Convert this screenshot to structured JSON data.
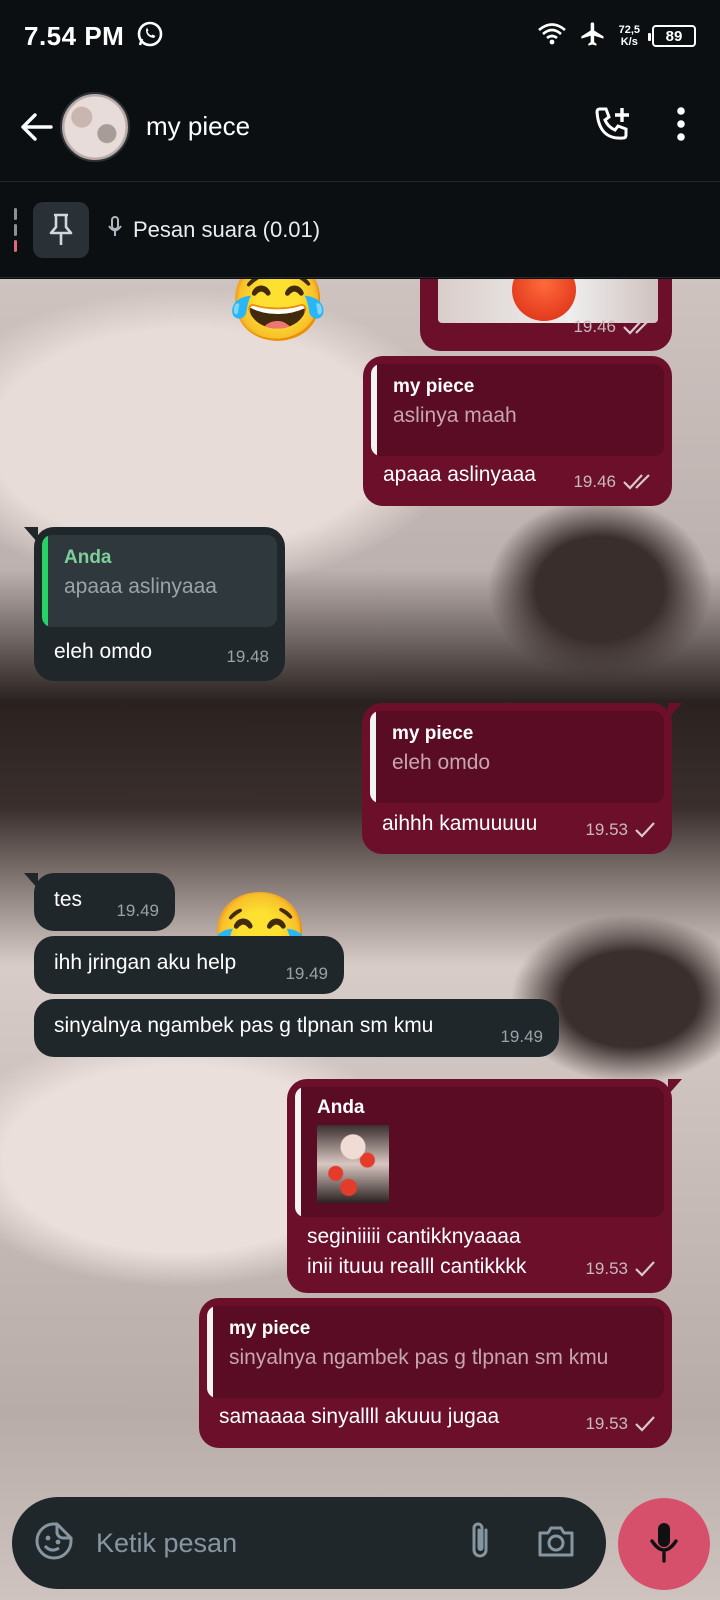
{
  "status_bar": {
    "time": "7.54 PM",
    "speed_value": "72,5",
    "speed_unit": "K/s",
    "battery": "89"
  },
  "header": {
    "contact_name": "my piece"
  },
  "pinned": {
    "label": "Pesan suara (0.01)"
  },
  "messages": [
    {
      "direction": "out",
      "time": "19.46",
      "status": "read",
      "type": "image-cut"
    },
    {
      "direction": "out",
      "quote_author": "my piece",
      "quote_text": "aslinya maah",
      "text": "apaaa aslinyaaa",
      "time": "19.46",
      "status": "read"
    },
    {
      "direction": "in",
      "quote_author": "Anda",
      "quote_text": "apaaa aslinyaaa",
      "text": "eleh omdo",
      "time": "19.48"
    },
    {
      "direction": "out",
      "quote_author": "my piece",
      "quote_text": "eleh omdo",
      "text": "aihhh kamuuuuu",
      "time": "19.53",
      "status": "sent"
    },
    {
      "direction": "in",
      "text": "tes",
      "time": "19.49"
    },
    {
      "direction": "in",
      "text": "ihh jringan aku help",
      "time": "19.49"
    },
    {
      "direction": "in",
      "text": "sinyalnya ngambek pas g tlpnan sm kmu",
      "time": "19.49"
    },
    {
      "direction": "out",
      "quote_author": "Anda",
      "quote_image": true,
      "text_line1": "seginiiiii cantikknyaaaa",
      "text_line2": "inii ituuu realll cantikkkk",
      "time": "19.53",
      "status": "sent"
    },
    {
      "direction": "out",
      "quote_author": "my piece",
      "quote_text": "sinyalnya ngambek pas g tlpnan sm kmu",
      "text": "samaaaa sinyallll akuuu jugaa",
      "time": "19.53",
      "status": "sent"
    }
  ],
  "input": {
    "placeholder": "Ketik pesan"
  },
  "colors": {
    "outgoing_bubble": "#6b0f2b",
    "incoming_bubble": "#1f272b",
    "mic_button": "#d6506c",
    "background": "#0b0f12"
  }
}
